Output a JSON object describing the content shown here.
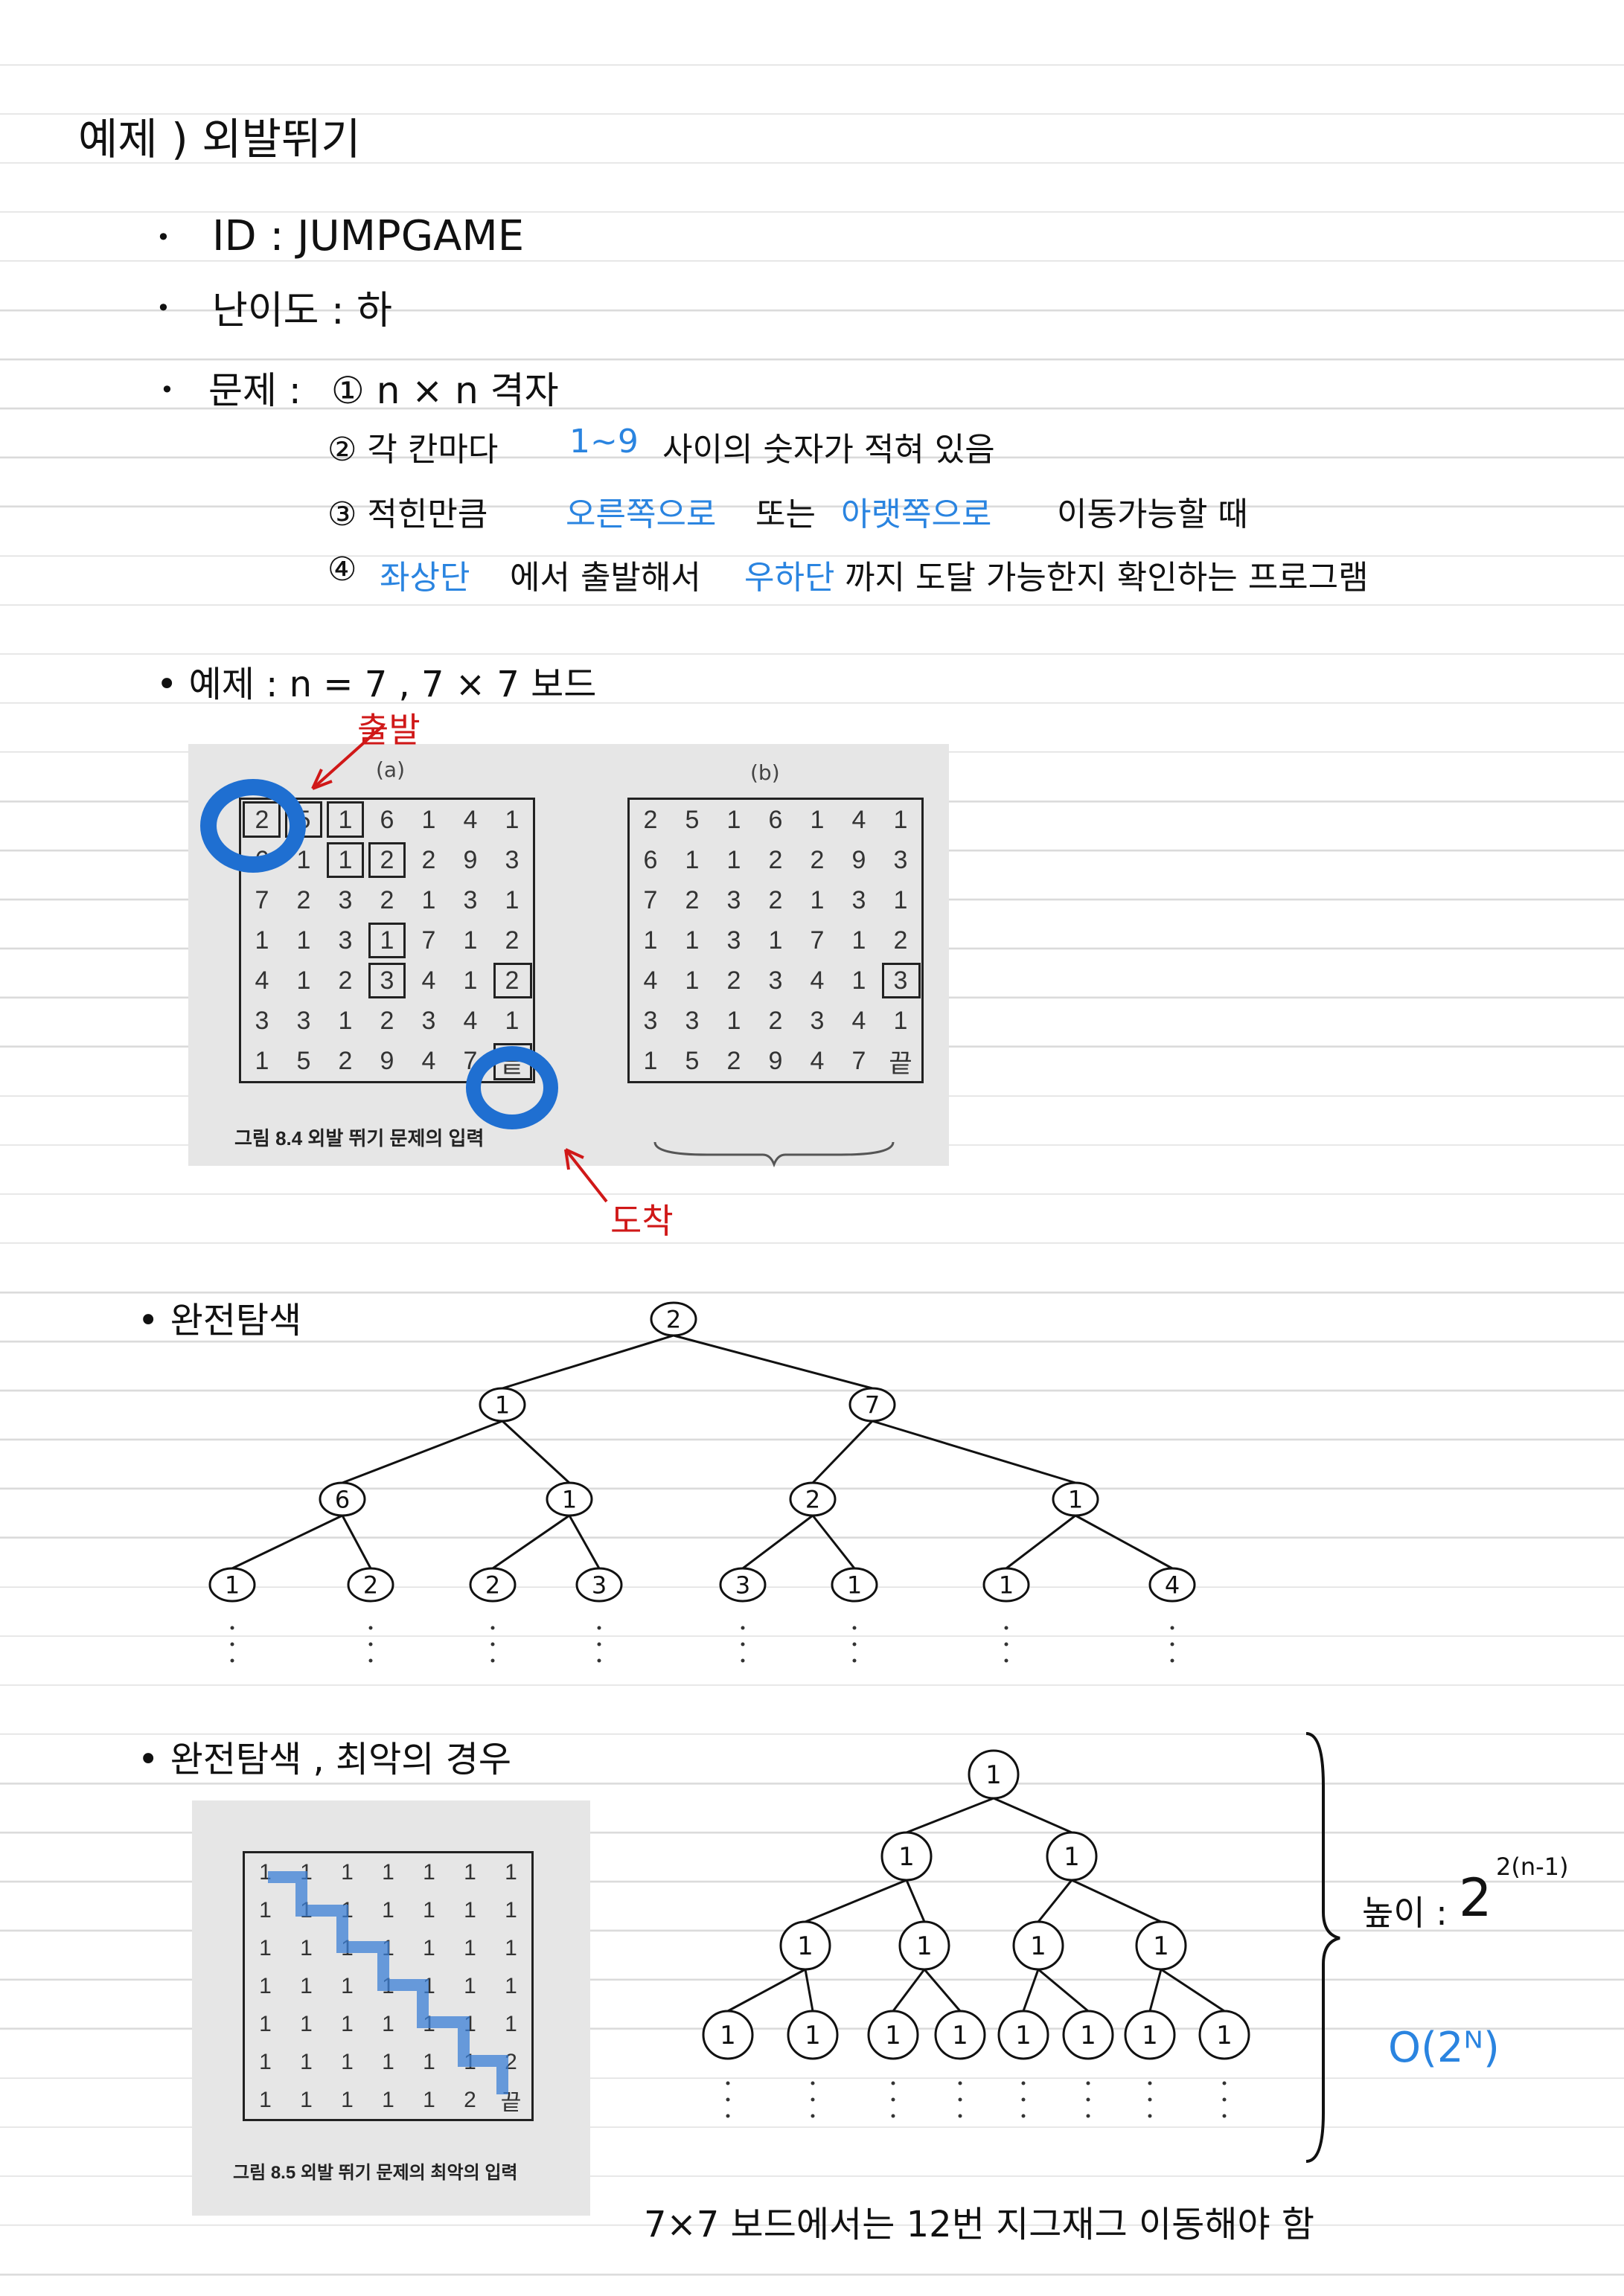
{
  "title": "예제 ) 외발뛰기",
  "id_line": "ID : JUMPGAME",
  "difficulty": "난이도 : 하",
  "problem": {
    "label": "문제 :",
    "p1": "① n × n 격자",
    "p2a": "② 각 칸마다",
    "p2b": "1~9",
    "p2c": "사이의 숫자가 적혀 있음",
    "p3a": "③ 적힌만큼",
    "p3b": "오른쪽으로",
    "p3c": "또는",
    "p3d": "아랫쪽으로",
    "p3e": "이동가능할 때",
    "p4a": "④",
    "p4b": "좌상단",
    "p4c": "에서 출발해서",
    "p4d": "우하단",
    "p4e": "까지 도달 가능한지 확인하는 프로그램"
  },
  "example": {
    "line": "• 예제 : n = 7 , 7 × 7 보드",
    "start": "출발",
    "arrive": "도착",
    "label_a": "(a)",
    "label_b": "(b)",
    "caption": "그림 8.4 외발 뛰기 문제의 입력",
    "grid_a": [
      [
        "2",
        "5",
        "1",
        "6",
        "1",
        "4",
        "1"
      ],
      [
        "6",
        "1",
        "1",
        "2",
        "2",
        "9",
        "3"
      ],
      [
        "7",
        "2",
        "3",
        "2",
        "1",
        "3",
        "1"
      ],
      [
        "1",
        "1",
        "3",
        "1",
        "7",
        "1",
        "2"
      ],
      [
        "4",
        "1",
        "2",
        "3",
        "4",
        "1",
        "2"
      ],
      [
        "3",
        "3",
        "1",
        "2",
        "3",
        "4",
        "1"
      ],
      [
        "1",
        "5",
        "2",
        "9",
        "4",
        "7",
        "끝"
      ]
    ],
    "grid_b": [
      [
        "2",
        "5",
        "1",
        "6",
        "1",
        "4",
        "1"
      ],
      [
        "6",
        "1",
        "1",
        "2",
        "2",
        "9",
        "3"
      ],
      [
        "7",
        "2",
        "3",
        "2",
        "1",
        "3",
        "1"
      ],
      [
        "1",
        "1",
        "3",
        "1",
        "7",
        "1",
        "2"
      ],
      [
        "4",
        "1",
        "2",
        "3",
        "4",
        "1",
        "3"
      ],
      [
        "3",
        "3",
        "1",
        "2",
        "3",
        "4",
        "1"
      ],
      [
        "1",
        "5",
        "2",
        "9",
        "4",
        "7",
        "끝"
      ]
    ]
  },
  "bruteforce": {
    "heading": "• 완전탐색",
    "tree": {
      "root": "2",
      "level1": [
        "1",
        "7"
      ],
      "level2": [
        "6",
        "1",
        "2",
        "1"
      ],
      "level3": [
        "1",
        "2",
        "2",
        "3",
        "3",
        "1",
        "1",
        "4"
      ]
    }
  },
  "worst": {
    "heading": "• 완전탐색 , 최악의 경우",
    "caption": "그림 8.5 외발 뛰기 문제의 최악의 입력",
    "grid": [
      [
        "1",
        "1",
        "1",
        "1",
        "1",
        "1",
        "1"
      ],
      [
        "1",
        "1",
        "1",
        "1",
        "1",
        "1",
        "1"
      ],
      [
        "1",
        "1",
        "1",
        "1",
        "1",
        "1",
        "1"
      ],
      [
        "1",
        "1",
        "1",
        "1",
        "1",
        "1",
        "1"
      ],
      [
        "1",
        "1",
        "1",
        "1",
        "1",
        "1",
        "1"
      ],
      [
        "1",
        "1",
        "1",
        "1",
        "1",
        "1",
        "2"
      ],
      [
        "1",
        "1",
        "1",
        "1",
        "1",
        "2",
        "끝"
      ]
    ],
    "tree_node": "1",
    "height_label": "높이 :",
    "height_base": "2",
    "height_exp": "2(n-1)",
    "complexity": "O(2ᴺ)",
    "footnote": "7×7 보드에서는 12번 지그재그 이동해야 함"
  },
  "colors": {
    "accent_blue": "#2a84e0",
    "red": "#d01818",
    "circle_blue": "#1f6fd1"
  }
}
